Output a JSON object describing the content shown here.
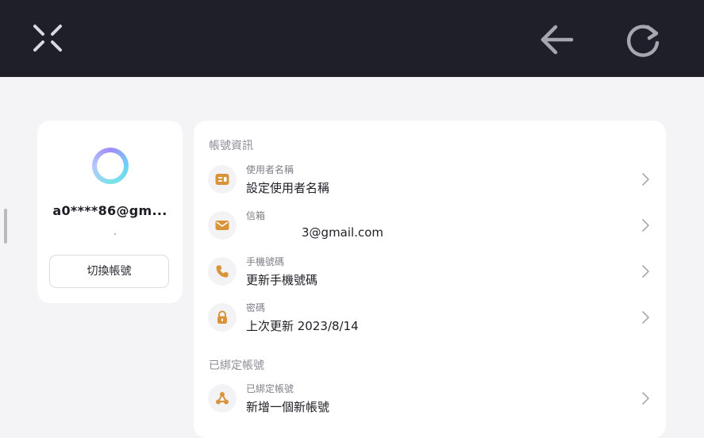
{
  "topbar": {
    "close_icon": "close-icon",
    "back_icon": "arrow-left-icon",
    "refresh_icon": "refresh-icon",
    "background": "#1f1f2a"
  },
  "profile": {
    "email_masked": "a0****86@gm...",
    "switch_account_label": "切換帳號"
  },
  "account_info": {
    "section_title": "帳號資訊",
    "rows": [
      {
        "icon": "id-card-icon",
        "label": "使用者名稱",
        "value": "設定使用者名稱"
      },
      {
        "icon": "mail-icon",
        "label": "信箱",
        "value": "3@gmail.com"
      },
      {
        "icon": "phone-icon",
        "label": "手機號碼",
        "value": "更新手機號碼"
      },
      {
        "icon": "lock-icon",
        "label": "密碼",
        "value": "上次更新 2023/8/14"
      }
    ]
  },
  "linked_accounts": {
    "section_title": "已綁定帳號",
    "rows": [
      {
        "icon": "link-nodes-icon",
        "label": "已綁定帳號",
        "value": "新增一個新帳號"
      }
    ]
  },
  "accent_color": "#d9943a"
}
